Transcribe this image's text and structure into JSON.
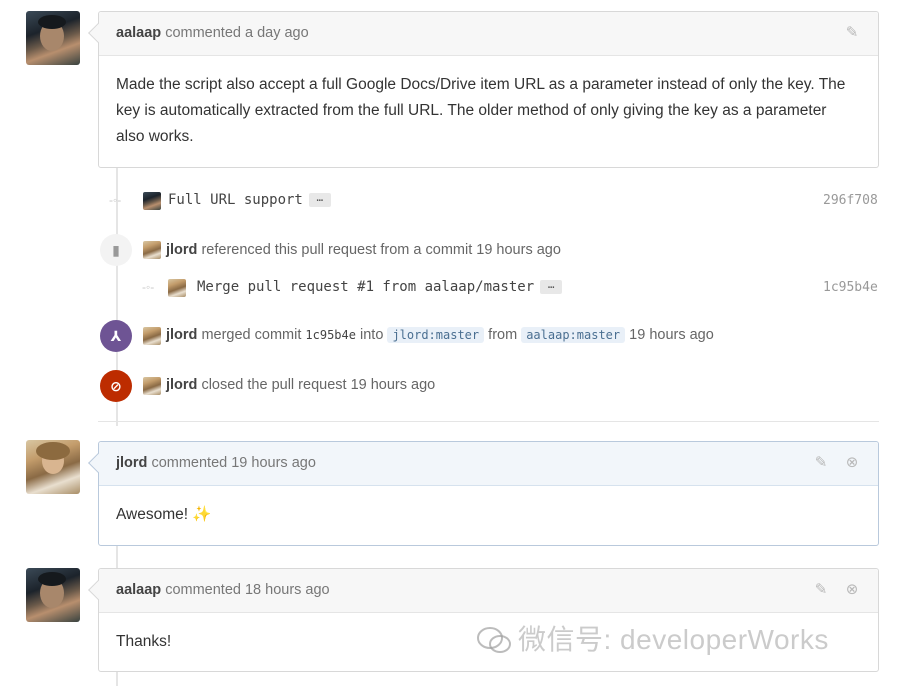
{
  "comments": [
    {
      "author": "aalaap",
      "action": "commented a day ago",
      "body": "Made the script also accept a full Google Docs/Drive item URL as a parameter instead of only the key. The key is automatically extracted from the full URL. The older method of only giving the key as a parameter also works."
    },
    {
      "author": "jlord",
      "action": "commented 19 hours ago",
      "body": "Awesome!",
      "emoji": "✨"
    },
    {
      "author": "aalaap",
      "action": "commented 18 hours ago",
      "body": "Thanks!"
    }
  ],
  "commit1": {
    "message": "Full URL support",
    "ellipsis": "…",
    "sha": "296f708"
  },
  "reference_event": {
    "user": "jlord",
    "text": "referenced this pull request from a commit 19 hours ago"
  },
  "commit2": {
    "message": "Merge pull request #1 from aalaap/master",
    "ellipsis": "…",
    "sha": "1c95b4e"
  },
  "merge_event": {
    "user": "jlord",
    "text1": "merged commit",
    "sha": "1c95b4e",
    "text2": "into",
    "base_branch": "jlord:master",
    "text3": "from",
    "head_branch": "aalaap:master",
    "time": "19 hours ago"
  },
  "close_event": {
    "user": "jlord",
    "text": "closed the pull request 19 hours ago"
  },
  "icons": {
    "edit": "pencil-icon",
    "delete": "x-circle-icon",
    "bookmark": "bookmark-icon",
    "merge": "git-merge-icon",
    "closed": "circle-slash-icon",
    "commit": "git-commit-icon"
  },
  "colors": {
    "merged": "#6e5494",
    "closed": "#bd2c00",
    "branch_bg": "#e9f0f8"
  },
  "watermark": "微信号: developerWorks"
}
